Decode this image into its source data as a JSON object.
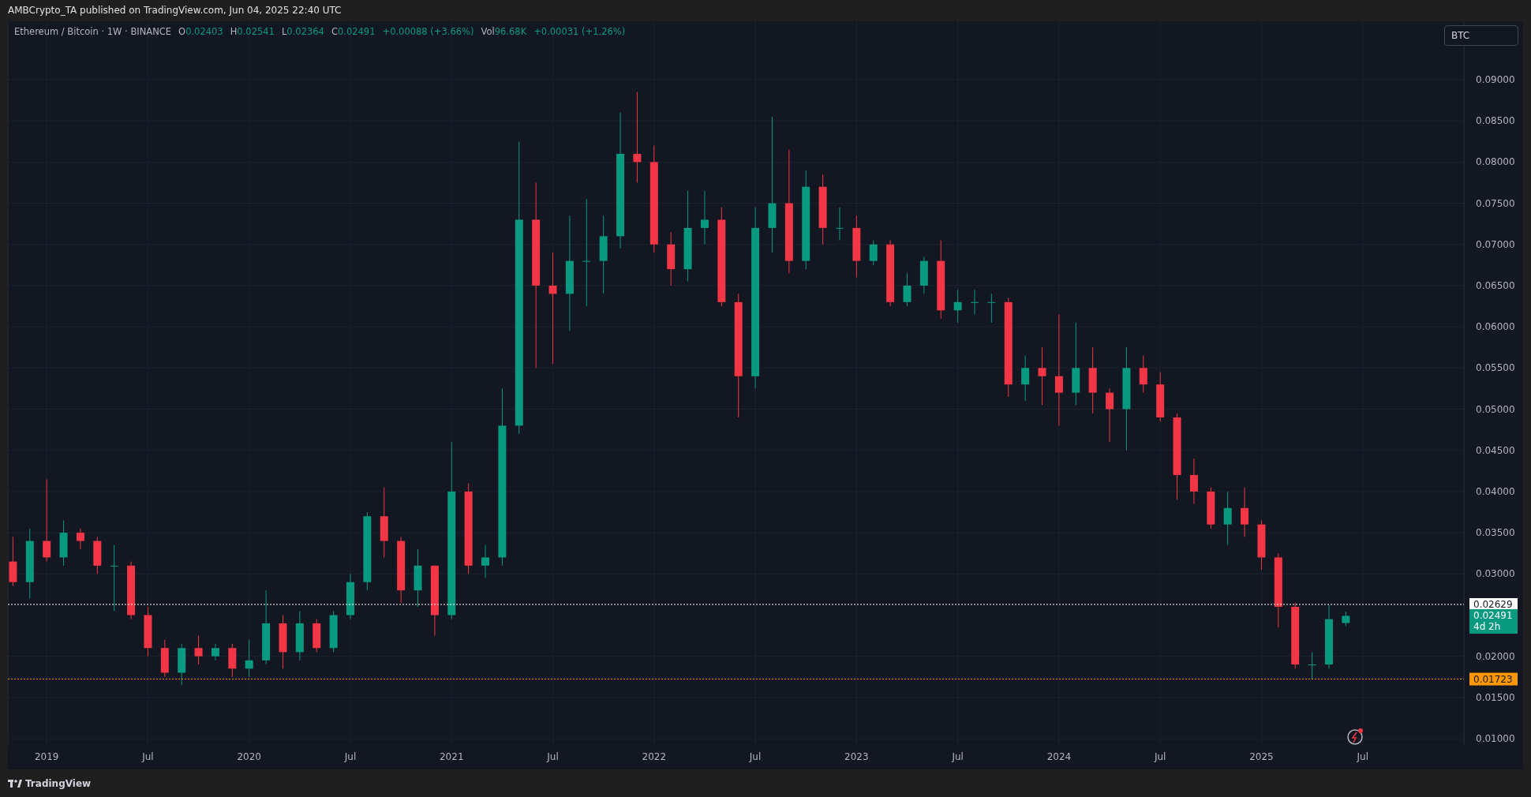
{
  "header": {
    "text": "AMBCrypto_TA published on TradingView.com, Jun 04, 2025 22:40 UTC"
  },
  "legend": {
    "symbol": "Ethereum / Bitcoin · 1W · BINANCE",
    "ohlc": [
      {
        "label": "O",
        "value": "0.02403"
      },
      {
        "label": "H",
        "value": "0.02541"
      },
      {
        "label": "L",
        "value": "0.02364"
      },
      {
        "label": "C",
        "value": "0.02491"
      }
    ],
    "change": "+0.00088 (+3.66%)",
    "volume_label": "Vol",
    "volume": "96.68K",
    "volume_change": "+0.00031 (+1.26%)"
  },
  "currency_button": {
    "label": "BTC"
  },
  "chart": {
    "chart_data": {
      "type": "candlestick",
      "grid": true,
      "x": [
        "2018-11",
        "2018-12",
        "2019-01",
        "2019-02",
        "2019-03",
        "2019-04",
        "2019-05",
        "2019-06",
        "2019-07",
        "2019-08",
        "2019-09",
        "2019-10",
        "2019-11",
        "2019-12",
        "2020-01",
        "2020-02",
        "2020-03",
        "2020-04",
        "2020-05",
        "2020-06",
        "2020-07",
        "2020-08",
        "2020-09",
        "2020-10",
        "2020-11",
        "2020-12",
        "2021-01",
        "2021-02",
        "2021-03",
        "2021-04",
        "2021-05",
        "2021-06",
        "2021-07",
        "2021-08",
        "2021-09",
        "2021-10",
        "2021-11",
        "2021-12",
        "2022-01",
        "2022-02",
        "2022-03",
        "2022-04",
        "2022-05",
        "2022-06",
        "2022-07",
        "2022-08",
        "2022-09",
        "2022-10",
        "2022-11",
        "2022-12",
        "2023-01",
        "2023-02",
        "2023-03",
        "2023-04",
        "2023-05",
        "2023-06",
        "2023-07",
        "2023-08",
        "2023-09",
        "2023-10",
        "2023-11",
        "2023-12",
        "2024-01",
        "2024-02",
        "2024-03",
        "2024-04",
        "2024-05",
        "2024-06",
        "2024-07",
        "2024-08",
        "2024-09",
        "2024-10",
        "2024-11",
        "2024-12",
        "2025-01",
        "2025-02",
        "2025-03",
        "2025-04",
        "2025-05",
        "2025-06"
      ],
      "ohlc": [
        [
          0.0315,
          0.0345,
          0.0285,
          0.029
        ],
        [
          0.029,
          0.0355,
          0.027,
          0.034
        ],
        [
          0.034,
          0.0415,
          0.0315,
          0.032
        ],
        [
          0.032,
          0.0365,
          0.031,
          0.035
        ],
        [
          0.035,
          0.0355,
          0.033,
          0.034
        ],
        [
          0.034,
          0.0345,
          0.03,
          0.031
        ],
        [
          0.031,
          0.0335,
          0.0255,
          0.031
        ],
        [
          0.031,
          0.0315,
          0.0245,
          0.025
        ],
        [
          0.025,
          0.026,
          0.02,
          0.021
        ],
        [
          0.021,
          0.022,
          0.0175,
          0.018
        ],
        [
          0.018,
          0.0215,
          0.0165,
          0.021
        ],
        [
          0.021,
          0.0225,
          0.019,
          0.02
        ],
        [
          0.02,
          0.0215,
          0.0195,
          0.021
        ],
        [
          0.021,
          0.0215,
          0.0175,
          0.0185
        ],
        [
          0.0185,
          0.022,
          0.0175,
          0.0195
        ],
        [
          0.0195,
          0.028,
          0.019,
          0.024
        ],
        [
          0.024,
          0.025,
          0.0185,
          0.0205
        ],
        [
          0.0205,
          0.0255,
          0.0195,
          0.024
        ],
        [
          0.024,
          0.0245,
          0.0205,
          0.021
        ],
        [
          0.021,
          0.0255,
          0.0205,
          0.025
        ],
        [
          0.025,
          0.03,
          0.0245,
          0.029
        ],
        [
          0.029,
          0.0375,
          0.028,
          0.037
        ],
        [
          0.037,
          0.0405,
          0.032,
          0.034
        ],
        [
          0.034,
          0.0345,
          0.0265,
          0.028
        ],
        [
          0.028,
          0.033,
          0.026,
          0.031
        ],
        [
          0.031,
          0.031,
          0.0225,
          0.025
        ],
        [
          0.025,
          0.046,
          0.0245,
          0.04
        ],
        [
          0.04,
          0.041,
          0.03,
          0.031
        ],
        [
          0.031,
          0.0335,
          0.0295,
          0.032
        ],
        [
          0.032,
          0.0525,
          0.031,
          0.048
        ],
        [
          0.048,
          0.0825,
          0.047,
          0.073
        ],
        [
          0.073,
          0.0775,
          0.055,
          0.065
        ],
        [
          0.065,
          0.069,
          0.0555,
          0.064
        ],
        [
          0.064,
          0.0735,
          0.0595,
          0.068
        ],
        [
          0.068,
          0.0755,
          0.0625,
          0.068
        ],
        [
          0.068,
          0.0735,
          0.064,
          0.071
        ],
        [
          0.071,
          0.086,
          0.0695,
          0.081
        ],
        [
          0.081,
          0.0885,
          0.0775,
          0.08
        ],
        [
          0.08,
          0.082,
          0.069,
          0.07
        ],
        [
          0.07,
          0.0715,
          0.065,
          0.067
        ],
        [
          0.067,
          0.0765,
          0.0655,
          0.072
        ],
        [
          0.072,
          0.0765,
          0.07,
          0.073
        ],
        [
          0.073,
          0.0745,
          0.0625,
          0.063
        ],
        [
          0.063,
          0.064,
          0.049,
          0.054
        ],
        [
          0.054,
          0.0745,
          0.0525,
          0.072
        ],
        [
          0.072,
          0.0855,
          0.069,
          0.075
        ],
        [
          0.075,
          0.0815,
          0.0665,
          0.068
        ],
        [
          0.068,
          0.079,
          0.067,
          0.077
        ],
        [
          0.077,
          0.0785,
          0.07,
          0.072
        ],
        [
          0.072,
          0.0745,
          0.0705,
          0.072
        ],
        [
          0.072,
          0.0735,
          0.066,
          0.068
        ],
        [
          0.068,
          0.0705,
          0.0675,
          0.07
        ],
        [
          0.07,
          0.0705,
          0.0625,
          0.063
        ],
        [
          0.063,
          0.0665,
          0.0625,
          0.065
        ],
        [
          0.065,
          0.0685,
          0.064,
          0.068
        ],
        [
          0.068,
          0.0705,
          0.061,
          0.062
        ],
        [
          0.062,
          0.0645,
          0.0605,
          0.063
        ],
        [
          0.063,
          0.0645,
          0.0615,
          0.063
        ],
        [
          0.063,
          0.064,
          0.0605,
          0.063
        ],
        [
          0.063,
          0.0635,
          0.0515,
          0.053
        ],
        [
          0.053,
          0.0565,
          0.051,
          0.055
        ],
        [
          0.055,
          0.0575,
          0.0505,
          0.054
        ],
        [
          0.054,
          0.0615,
          0.048,
          0.052
        ],
        [
          0.052,
          0.0605,
          0.0505,
          0.055
        ],
        [
          0.055,
          0.0575,
          0.0495,
          0.052
        ],
        [
          0.052,
          0.0525,
          0.046,
          0.05
        ],
        [
          0.05,
          0.0575,
          0.045,
          0.055
        ],
        [
          0.055,
          0.0565,
          0.052,
          0.053
        ],
        [
          0.053,
          0.0545,
          0.0485,
          0.049
        ],
        [
          0.049,
          0.0495,
          0.039,
          0.042
        ],
        [
          0.042,
          0.044,
          0.0385,
          0.04
        ],
        [
          0.04,
          0.0405,
          0.0355,
          0.036
        ],
        [
          0.036,
          0.04,
          0.0335,
          0.038
        ],
        [
          0.038,
          0.0405,
          0.0345,
          0.036
        ],
        [
          0.036,
          0.0365,
          0.0305,
          0.032
        ],
        [
          0.032,
          0.0325,
          0.0235,
          0.026
        ],
        [
          0.026,
          0.0265,
          0.0185,
          0.019
        ],
        [
          0.019,
          0.0205,
          0.01723,
          0.019
        ],
        [
          0.019,
          0.02625,
          0.0185,
          0.0245
        ],
        [
          0.02403,
          0.02541,
          0.02364,
          0.02491
        ]
      ],
      "xlim": [
        "2018-11",
        "2026-01"
      ],
      "ylim": [
        0.00914,
        0.09709
      ],
      "xticks": [
        {
          "value": "2019-01",
          "label": "2019"
        },
        {
          "value": "2019-07",
          "label": "Jul"
        },
        {
          "value": "2020-01",
          "label": "2020"
        },
        {
          "value": "2020-07",
          "label": "Jul"
        },
        {
          "value": "2021-01",
          "label": "2021"
        },
        {
          "value": "2021-07",
          "label": "Jul"
        },
        {
          "value": "2022-01",
          "label": "2022"
        },
        {
          "value": "2022-07",
          "label": "Jul"
        },
        {
          "value": "2023-01",
          "label": "2023"
        },
        {
          "value": "2023-07",
          "label": "Jul"
        },
        {
          "value": "2024-01",
          "label": "2024"
        },
        {
          "value": "2024-07",
          "label": "Jul"
        },
        {
          "value": "2025-01",
          "label": "2025"
        },
        {
          "value": "2025-07",
          "label": "Jul"
        }
      ],
      "yticks": [
        {
          "value": 0.01,
          "label": "0.01000"
        },
        {
          "value": 0.015,
          "label": "0.01500"
        },
        {
          "value": 0.02,
          "label": "0.02000"
        },
        {
          "value": 0.03,
          "label": "0.03000"
        },
        {
          "value": 0.035,
          "label": "0.03500"
        },
        {
          "value": 0.04,
          "label": "0.04000"
        },
        {
          "value": 0.045,
          "label": "0.04500"
        },
        {
          "value": 0.05,
          "label": "0.05000"
        },
        {
          "value": 0.055,
          "label": "0.05500"
        },
        {
          "value": 0.06,
          "label": "0.06000"
        },
        {
          "value": 0.065,
          "label": "0.06500"
        },
        {
          "value": 0.07,
          "label": "0.07000"
        },
        {
          "value": 0.075,
          "label": "0.07500"
        },
        {
          "value": 0.08,
          "label": "0.08000"
        },
        {
          "value": 0.085,
          "label": "0.08500"
        },
        {
          "value": 0.09,
          "label": "0.09000"
        }
      ],
      "ref_lines": [
        {
          "axis": "y",
          "value": 0.02629,
          "color": "#ffffff",
          "label": "0.02629"
        },
        {
          "axis": "y",
          "value": 0.01723,
          "color": "#ff9800",
          "label": "0.01723"
        }
      ]
    },
    "last_price": {
      "value": "0.02491",
      "countdown": "4d 2h",
      "color": "#089981"
    }
  },
  "footer": {
    "logo_text": "TradingView"
  }
}
